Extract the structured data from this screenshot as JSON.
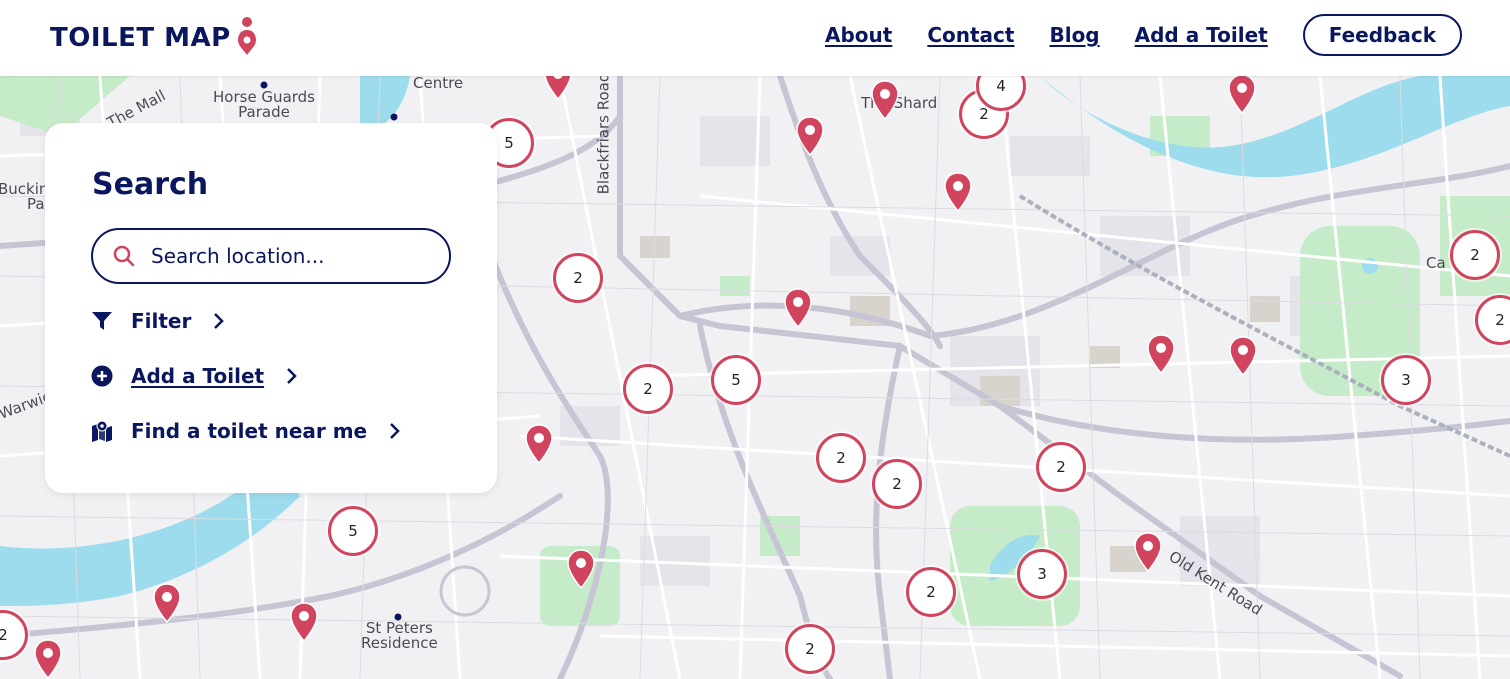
{
  "header": {
    "logo_text": "TOILET MAP",
    "nav": [
      "About",
      "Contact",
      "Blog",
      "Add a Toilet"
    ],
    "feedback_label": "Feedback"
  },
  "search_panel": {
    "title": "Search",
    "search_placeholder": "Search location...",
    "filter_label": "Filter",
    "add_toilet_label": "Add a Toilet",
    "find_near_label": "Find a toilet near me"
  },
  "map": {
    "labels": [
      "Centre",
      "Horse Guards\nParade",
      "The Mall",
      "Bucking\nPala",
      "Blackfriars Road",
      "The Shard",
      "Warwic",
      "St Peters\nResidence",
      "Old Kent Road",
      "Ca"
    ],
    "clusters": [
      "5",
      "2",
      "4",
      "2",
      "2",
      "5",
      "2",
      "2",
      "2",
      "2",
      "3",
      "2",
      "3",
      "5",
      "2",
      "2",
      "2"
    ]
  },
  "colors": {
    "brand_navy": "#0a165e",
    "marker_red": "#d0445e",
    "water": "#9ddcec",
    "park": "#c6ebc8"
  }
}
